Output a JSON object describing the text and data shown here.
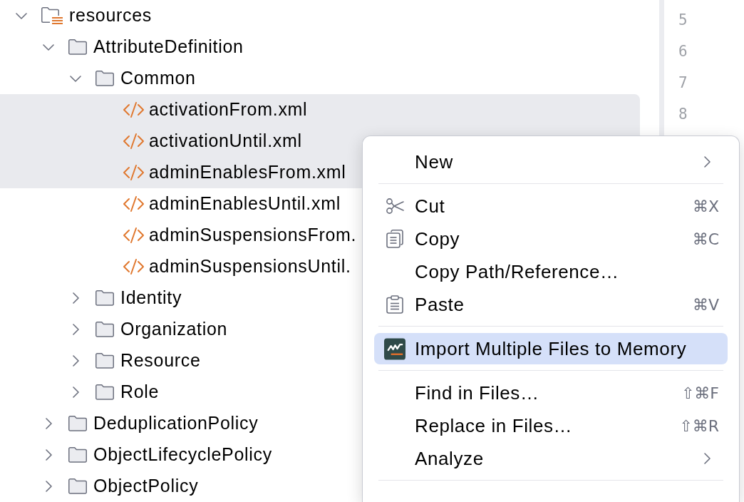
{
  "tree": [
    {
      "kind": "resources_folder",
      "label": "resources",
      "expanded": true,
      "selected": false,
      "children": [
        {
          "kind": "folder",
          "label": "AttributeDefinition",
          "expanded": true,
          "selected": false,
          "children": [
            {
              "kind": "folder",
              "label": "Common",
              "expanded": true,
              "selected": false,
              "children": [
                {
                  "kind": "xml_file",
                  "label": "activationFrom.xml",
                  "selected": true
                },
                {
                  "kind": "xml_file",
                  "label": "activationUntil.xml",
                  "selected": true
                },
                {
                  "kind": "xml_file",
                  "label": "adminEnablesFrom.xml",
                  "selected": true
                },
                {
                  "kind": "xml_file",
                  "label": "adminEnablesUntil.xml",
                  "selected": false
                },
                {
                  "kind": "xml_file",
                  "label": "adminSuspensionsFrom.",
                  "selected": false
                },
                {
                  "kind": "xml_file",
                  "label": "adminSuspensionsUntil.",
                  "selected": false
                }
              ]
            },
            {
              "kind": "folder",
              "label": "Identity",
              "expanded": false,
              "selected": false
            },
            {
              "kind": "folder",
              "label": "Organization",
              "expanded": false,
              "selected": false
            },
            {
              "kind": "folder",
              "label": "Resource",
              "expanded": false,
              "selected": false
            },
            {
              "kind": "folder",
              "label": "Role",
              "expanded": false,
              "selected": false
            }
          ]
        },
        {
          "kind": "folder",
          "label": "DeduplicationPolicy",
          "expanded": false,
          "selected": false
        },
        {
          "kind": "folder",
          "label": "ObjectLifecyclePolicy",
          "expanded": false,
          "selected": false
        },
        {
          "kind": "folder",
          "label": "ObjectPolicy",
          "expanded": false,
          "selected": false
        }
      ]
    }
  ],
  "gutter": {
    "line_numbers": [
      "5",
      "6",
      "7",
      "8"
    ]
  },
  "context_menu": {
    "groups": [
      {
        "items": [
          {
            "kind": "plain",
            "label": "New",
            "submenu": true,
            "selected": false
          }
        ]
      },
      {
        "items": [
          {
            "kind": "cut",
            "label": "Cut",
            "shortcut": "⌘X",
            "submenu": false,
            "selected": false
          },
          {
            "kind": "copy",
            "label": "Copy",
            "shortcut": "⌘C",
            "submenu": false,
            "selected": false
          },
          {
            "kind": "plain",
            "label": "Copy Path/Reference…",
            "submenu": false,
            "selected": false
          },
          {
            "kind": "paste",
            "label": "Paste",
            "shortcut": "⌘V",
            "submenu": false,
            "selected": false
          }
        ]
      },
      {
        "items": [
          {
            "kind": "plugin",
            "label": "Import Multiple Files to Memory",
            "submenu": false,
            "selected": true
          }
        ]
      },
      {
        "items": [
          {
            "kind": "plain",
            "label": "Find in Files…",
            "shortcut": "⇧⌘F",
            "submenu": false,
            "selected": false
          },
          {
            "kind": "plain",
            "label": "Replace in Files…",
            "shortcut": "⇧⌘R",
            "submenu": false,
            "selected": false
          },
          {
            "kind": "plain",
            "label": "Analyze",
            "submenu": true,
            "selected": false
          }
        ]
      }
    ]
  }
}
